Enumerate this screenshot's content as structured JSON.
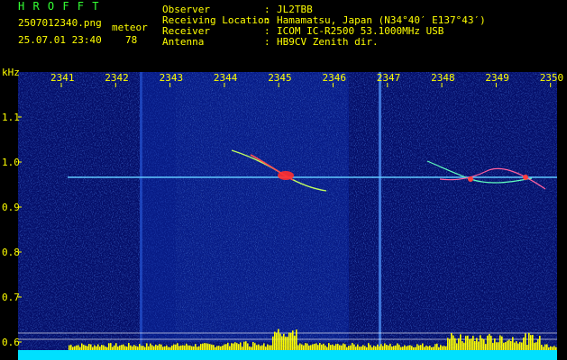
{
  "app": {
    "title": "H R O F F T"
  },
  "file": {
    "name": "2507012340.png",
    "datetime": "25.07.01 23:40"
  },
  "mode": {
    "label": "meteor",
    "count": "78"
  },
  "station": {
    "rows": [
      {
        "key": "Observer",
        "value": "JL2TBB"
      },
      {
        "key": "Receiving Location",
        "value": "Hamamatsu, Japan (N34°40′ E137°43′)"
      },
      {
        "key": "Receiver",
        "value": "ICOM IC-R2500 53.1000MHz USB"
      },
      {
        "key": "Antenna",
        "value": "HB9CV Zenith dir."
      }
    ],
    "sep": ":"
  },
  "axis": {
    "unit": "kHz",
    "x_ticks": [
      "2341",
      "2342",
      "2343",
      "2344",
      "2345",
      "2346",
      "2347",
      "2348",
      "2349",
      "2350"
    ],
    "y_ticks": [
      "1.1",
      "1.0",
      "0.9",
      "0.8",
      "0.7",
      "0.6"
    ]
  },
  "colors": {
    "background": "#000000",
    "header_text": "#ffff00",
    "title_text": "#33ff33",
    "spectrum": "#0a1a8a",
    "carrier_line": "#60c8ff",
    "level_fill": "#00e0ff",
    "level_peak": "#ffff00"
  }
}
